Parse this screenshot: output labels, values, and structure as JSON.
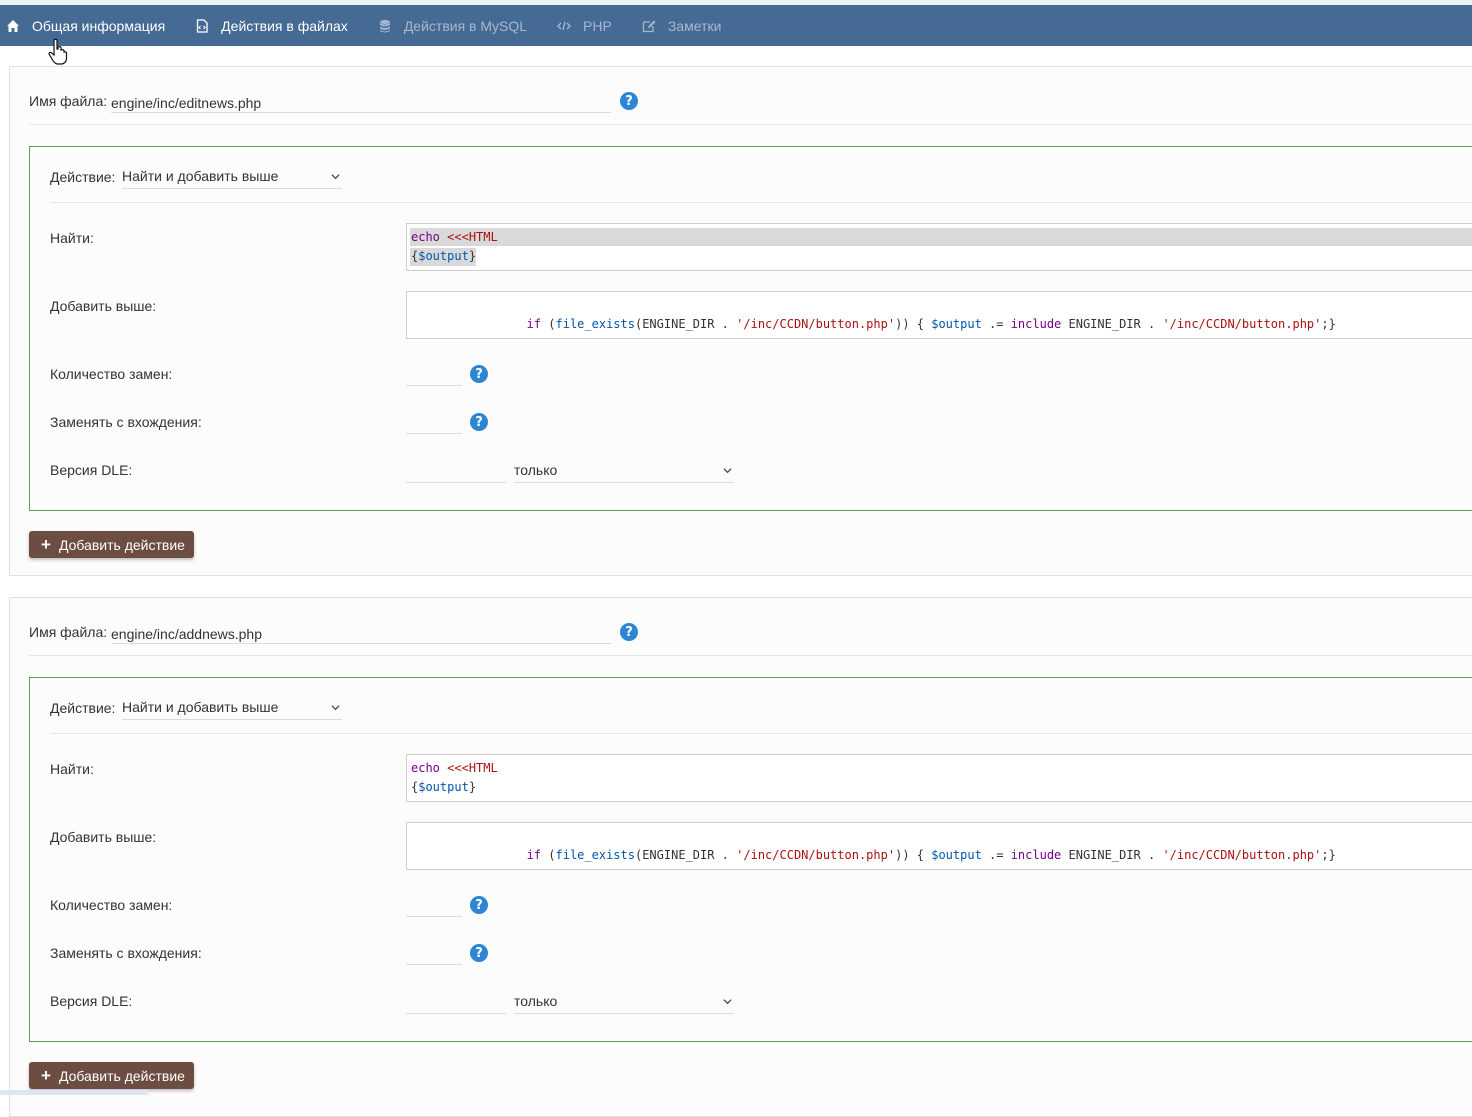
{
  "nav": {
    "tabs": [
      {
        "label": "Общая информация",
        "icon": "home-icon",
        "active": true
      },
      {
        "label": "Действия в файлах",
        "icon": "file-code-icon",
        "active": false
      },
      {
        "label": "Действия в MySQL",
        "icon": "database-icon",
        "active": false
      },
      {
        "label": "PHP",
        "icon": "code-icon",
        "active": false
      },
      {
        "label": "Заметки",
        "icon": "edit-icon",
        "active": false
      }
    ]
  },
  "colors": {
    "navbar": "#456a93",
    "action_border": "#57a55a",
    "button": "#6d4c41",
    "help": "#2c86d4"
  },
  "blocks": [
    {
      "file_label": "Имя файла:",
      "file_value": "engine/inc/editnews.php",
      "action": {
        "label": "Действие:",
        "select_value": "Найти и добавить выше",
        "find_label": "Найти:",
        "find_code": [
          "echo <<<HTML",
          "{$output}"
        ],
        "add_label": "Добавить выше:",
        "add_code": "if (file_exists(ENGINE_DIR . '/inc/CCDN/button.php')) { $output .= include ENGINE_DIR . '/inc/CCDN/button.php';}",
        "count_label": "Количество замен:",
        "from_label": "Заменять с вхождения:",
        "version_label": "Версия DLE:",
        "version_mode": "только"
      },
      "add_button": "Добавить действие"
    },
    {
      "file_label": "Имя файла:",
      "file_value": "engine/inc/addnews.php",
      "action": {
        "label": "Действие:",
        "select_value": "Найти и добавить выше",
        "find_label": "Найти:",
        "find_code": [
          "echo <<<HTML",
          "{$output}"
        ],
        "add_label": "Добавить выше:",
        "add_code": "if (file_exists(ENGINE_DIR . '/inc/CCDN/button.php')) { $output .= include ENGINE_DIR . '/inc/CCDN/button.php';}",
        "count_label": "Количество замен:",
        "from_label": "Заменять с вхождения:",
        "version_label": "Версия DLE:",
        "version_mode": "только"
      },
      "add_button": "Добавить действие"
    }
  ]
}
